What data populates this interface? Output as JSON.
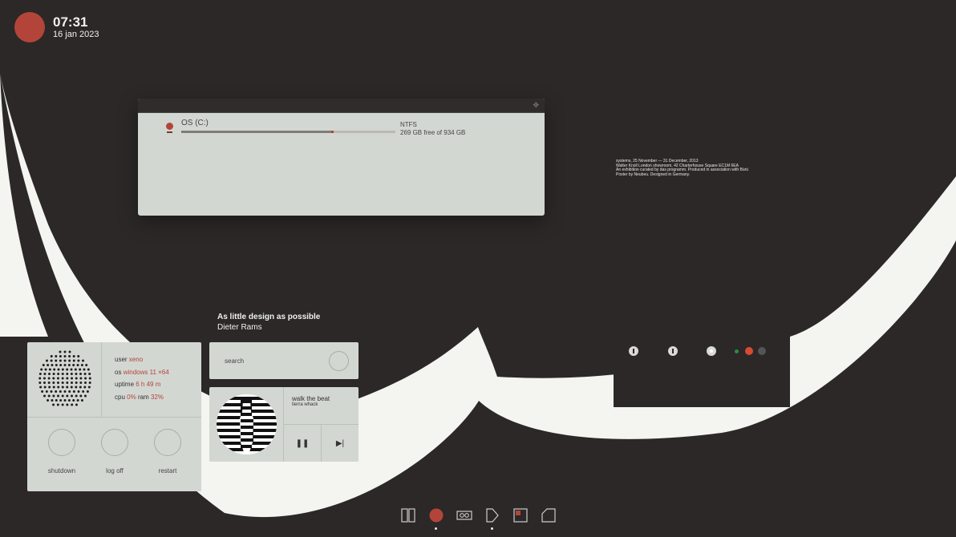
{
  "clock": {
    "time": "07:31",
    "date": "16 jan 2023"
  },
  "disk": {
    "drive_name": "OS (C:)",
    "filesystem": "NTFS",
    "free_text": "269 GB free of 934 GB",
    "used_fraction": 0.712
  },
  "quote": {
    "line": "As little design as possible",
    "author": "Dieter Rams"
  },
  "system": {
    "user_label": "user",
    "user_value": "xeno",
    "os_label": "os",
    "os_value": "windows 11 ×64",
    "uptime_label": "uptime",
    "uptime_value": "6 h 49 m",
    "cpu_label": "cpu",
    "cpu_value": "0%",
    "ram_label": "ram",
    "ram_value": "32%",
    "buttons": [
      "shutdown",
      "log off",
      "restart"
    ]
  },
  "search": {
    "label": "search"
  },
  "player": {
    "title": "walk the beat",
    "artist": "tierra whack"
  },
  "poster": {
    "lines": [
      "systems, 25 November — 31 December, 2013",
      "Walter Knoll London showroom, 42 Charterhouse Square EC1M 6EA",
      "An exhibition curated by das programm. Produced in association with Bürü",
      "Poster by Neubeu. Designed in Germany."
    ]
  },
  "dock": {
    "icons": [
      "columns-icon",
      "record-icon",
      "cassette-icon",
      "play-icon",
      "window-icon",
      "folder-icon"
    ]
  },
  "colors": {
    "accent": "#b3443a",
    "panel": "#d3d7d2",
    "background": "#2b2827",
    "cream": "#f4f4f0"
  }
}
